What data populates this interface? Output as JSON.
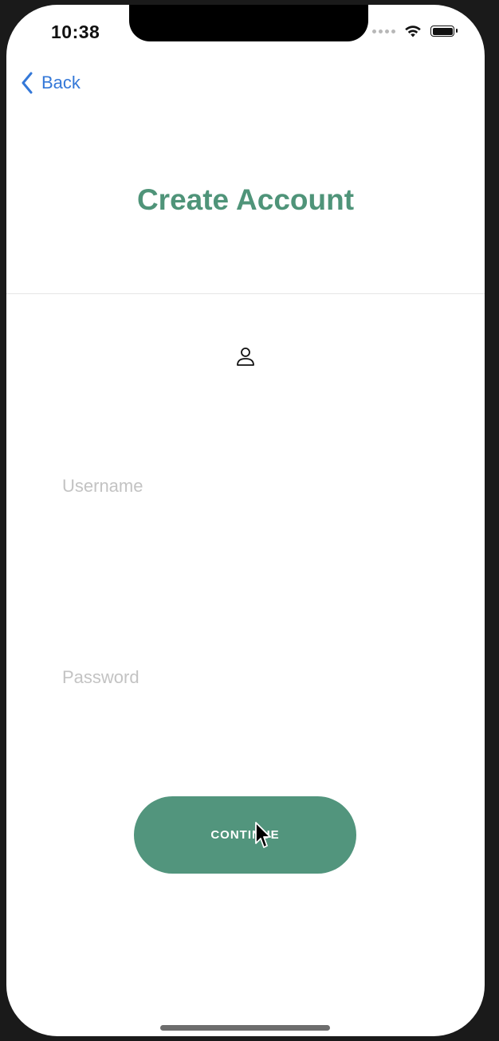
{
  "status_bar": {
    "time": "10:38"
  },
  "nav": {
    "back_label": "Back"
  },
  "header": {
    "title": "Create Account"
  },
  "form": {
    "username_placeholder": "Username",
    "username_value": "",
    "password_placeholder": "Password",
    "password_value": "",
    "continue_label": "CONTINUE"
  },
  "icons": [
    "back-chevron-icon",
    "user-icon",
    "wifi-icon",
    "battery-icon",
    "signal-icon",
    "cursor-icon"
  ],
  "colors": {
    "accent": "#4f9479",
    "button": "#52957d",
    "link": "#3478d8"
  }
}
